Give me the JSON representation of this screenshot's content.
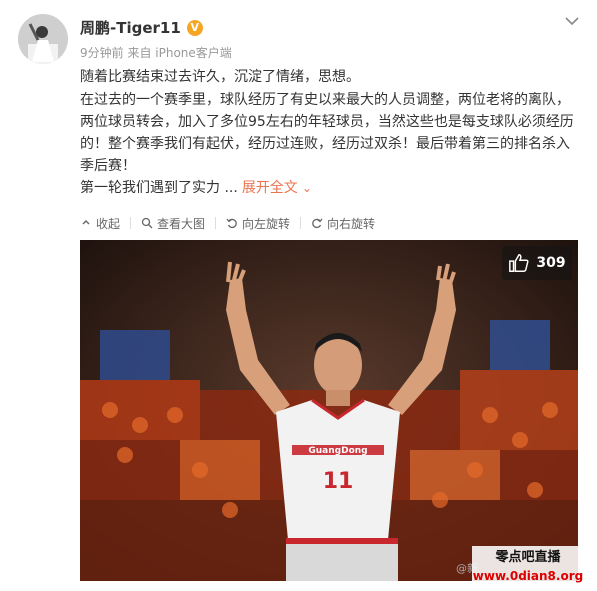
{
  "user": {
    "name": "周鹏-Tiger11",
    "badge": "V",
    "meta": "9分钟前 来自 iPhone客户端"
  },
  "post": {
    "line1": "随着比赛结束过去许久，沉淀了情绪，思想。",
    "para2": "在过去的一个赛季里，球队经历了有史以来最大的人员调整，两位老将的离队，两位球员转会，加入了多位95左右的年轻球员，当然这些也是每支球队必须经历的！整个赛季我们有起伏，经历过连败，经历过双杀！最后带着第三的排名杀入季后赛！",
    "line3": "第一轮我们遇到了实力 ...",
    "expand_label": "展开全文",
    "expand_chevron": "⌄"
  },
  "toolbar": {
    "collapse": "收起",
    "view_large": "查看大图",
    "rotate_left": "向左旋转",
    "rotate_right": "向右旋转"
  },
  "photo": {
    "like_count": "309",
    "jersey_team": "GuangDong",
    "jersey_number": "11"
  },
  "watermark": {
    "weibo": "@新",
    "site_name": "零点吧直播",
    "site_url": "www.0dian8.org"
  },
  "colors": {
    "link": "#eb7350",
    "badge": "#f5a623"
  }
}
